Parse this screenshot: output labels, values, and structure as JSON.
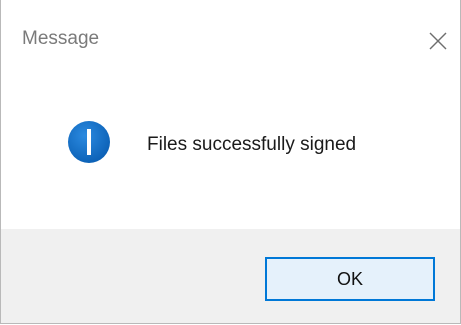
{
  "dialog": {
    "title": "Message",
    "message": "Files successfully signed",
    "icon": "info-icon",
    "ok_label": "OK",
    "close_icon": "close-icon"
  },
  "colors": {
    "accent": "#0078d7",
    "icon_blue": "#0a69c7",
    "footer_bg": "#f0f0f0",
    "button_bg": "#e5f1fb"
  }
}
